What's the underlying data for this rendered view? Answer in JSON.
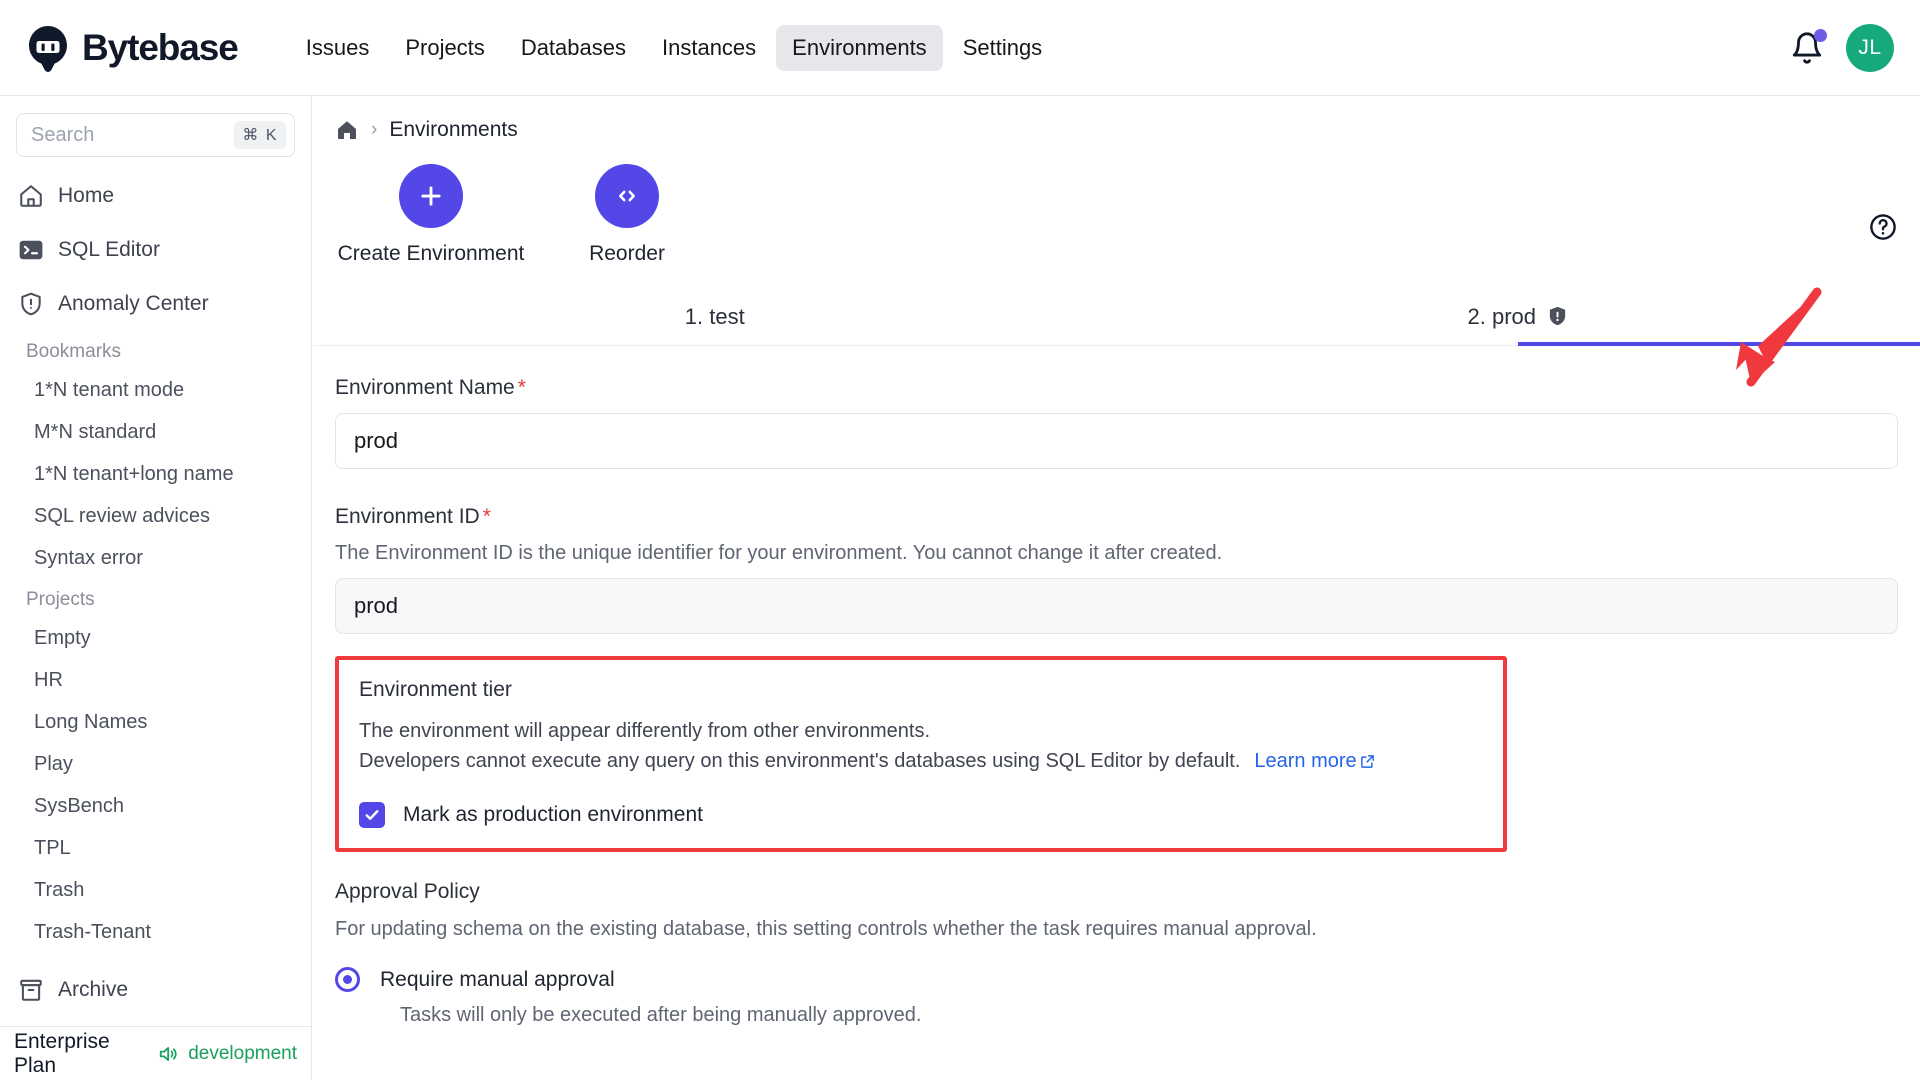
{
  "brand": {
    "name": "Bytebase",
    "logo_icon": "bytebase-logo-icon"
  },
  "topnav": {
    "items": [
      {
        "label": "Issues",
        "active": false
      },
      {
        "label": "Projects",
        "active": false
      },
      {
        "label": "Databases",
        "active": false
      },
      {
        "label": "Instances",
        "active": false
      },
      {
        "label": "Environments",
        "active": true
      },
      {
        "label": "Settings",
        "active": false
      }
    ],
    "bell_icon": "bell-icon",
    "bell_badge": true,
    "avatar_initials": "JL",
    "avatar_color": "#16a97c"
  },
  "sidebar": {
    "search": {
      "placeholder": "Search",
      "shortcut": "⌘ K"
    },
    "links": [
      {
        "label": "Home",
        "icon": "home-icon"
      },
      {
        "label": "SQL Editor",
        "icon": "terminal-icon"
      },
      {
        "label": "Anomaly Center",
        "icon": "shield-alert-icon"
      }
    ],
    "bookmarks_label": "Bookmarks",
    "bookmarks": [
      {
        "label": "1*N tenant mode"
      },
      {
        "label": "M*N standard"
      },
      {
        "label": "1*N tenant+long name"
      },
      {
        "label": "SQL review advices"
      },
      {
        "label": "Syntax error"
      }
    ],
    "projects_label": "Projects",
    "projects": [
      {
        "label": "Empty"
      },
      {
        "label": "HR"
      },
      {
        "label": "Long Names"
      },
      {
        "label": "Play"
      },
      {
        "label": "SysBench"
      },
      {
        "label": "TPL"
      },
      {
        "label": "Trash"
      },
      {
        "label": "Trash-Tenant"
      }
    ],
    "archive": {
      "label": "Archive",
      "icon": "archive-icon"
    },
    "footer": {
      "plan": "Enterprise Plan",
      "mode": "development",
      "mode_icon": "speaker-icon"
    }
  },
  "main": {
    "breadcrumb": {
      "home_icon": "home-icon",
      "separator": "›",
      "current": "Environments"
    },
    "help_icon": "question-circle-icon",
    "actions": [
      {
        "label": "Create Environment",
        "icon": "plus-icon"
      },
      {
        "label": "Reorder",
        "icon": "code-brackets-icon"
      }
    ],
    "tabs": [
      {
        "label": "1. test",
        "active": false,
        "badge_icon": null
      },
      {
        "label": "2. prod",
        "active": true,
        "badge_icon": "shield-exclamation-icon"
      }
    ],
    "annotation": {
      "type": "red-arrow",
      "color": "#f0393e",
      "points_to": "2. prod"
    },
    "form": {
      "env_name_label": "Environment Name",
      "env_name_required": "*",
      "env_name_value": "prod",
      "env_id_label": "Environment ID",
      "env_id_required": "*",
      "env_id_desc": "The Environment ID is the unique identifier for your environment. You cannot change it after created.",
      "env_id_value": "prod"
    },
    "tier": {
      "highlight_color": "#f0393e",
      "title": "Environment tier",
      "line1": "The environment will appear differently from other environments.",
      "line2": "Developers cannot execute any query on this environment's databases using SQL Editor by default.",
      "learn_more": "Learn more",
      "learn_more_icon": "external-link-icon",
      "checkbox_checked": true,
      "checkbox_label": "Mark as production environment"
    },
    "approval": {
      "title": "Approval Policy",
      "desc": "For updating schema on the existing database, this setting controls whether the task requires manual approval.",
      "option_label": "Require manual approval",
      "option_selected": true,
      "option_desc": "Tasks will only be executed after being manually approved."
    }
  }
}
